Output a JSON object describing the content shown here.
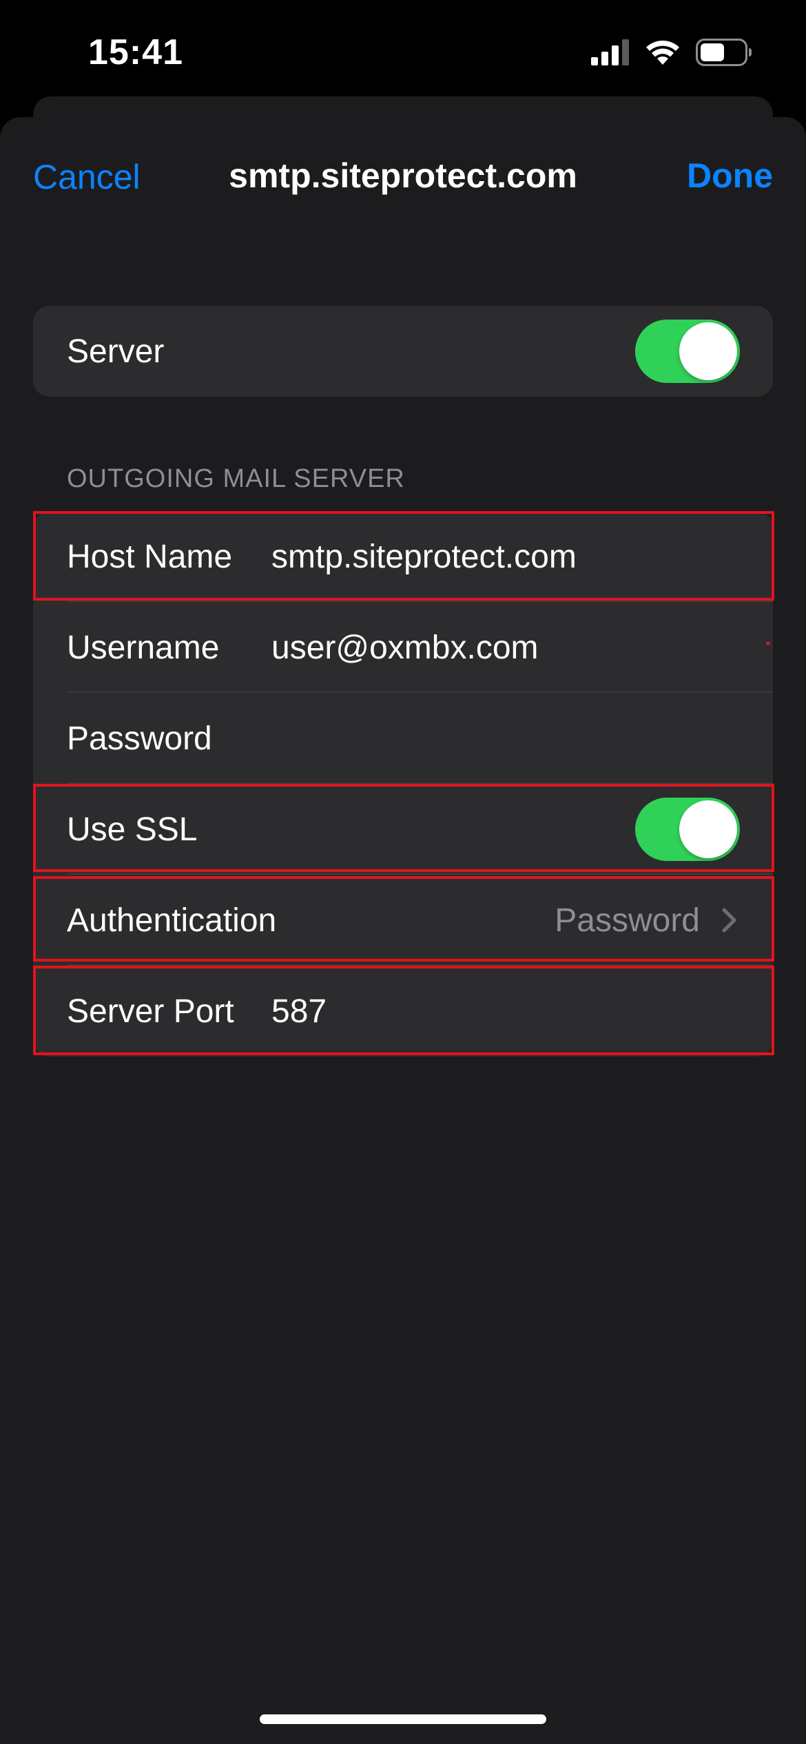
{
  "status_bar": {
    "time": "15:41",
    "icons": [
      "cellular-signal-icon",
      "wifi-icon",
      "battery-icon"
    ]
  },
  "nav": {
    "cancel_label": "Cancel",
    "title": "smtp.siteprotect.com",
    "done_label": "Done"
  },
  "server_row": {
    "label": "Server",
    "toggle_on": true
  },
  "outgoing_section": {
    "header": "OUTGOING MAIL SERVER",
    "host_name_label": "Host Name",
    "host_name_value": "smtp.siteprotect.com",
    "username_label": "Username",
    "username_value": "user@oxmbx.com",
    "password_label": "Password",
    "password_value": "",
    "use_ssl_label": "Use SSL",
    "use_ssl_on": true,
    "authentication_label": "Authentication",
    "authentication_value": "Password",
    "server_port_label": "Server Port",
    "server_port_value": "587"
  },
  "colors": {
    "accent": "#0a84ff",
    "toggle_on": "#30d158",
    "highlight": "#e0141e",
    "background": "#1c1c1e",
    "card": "#2c2c2e"
  }
}
